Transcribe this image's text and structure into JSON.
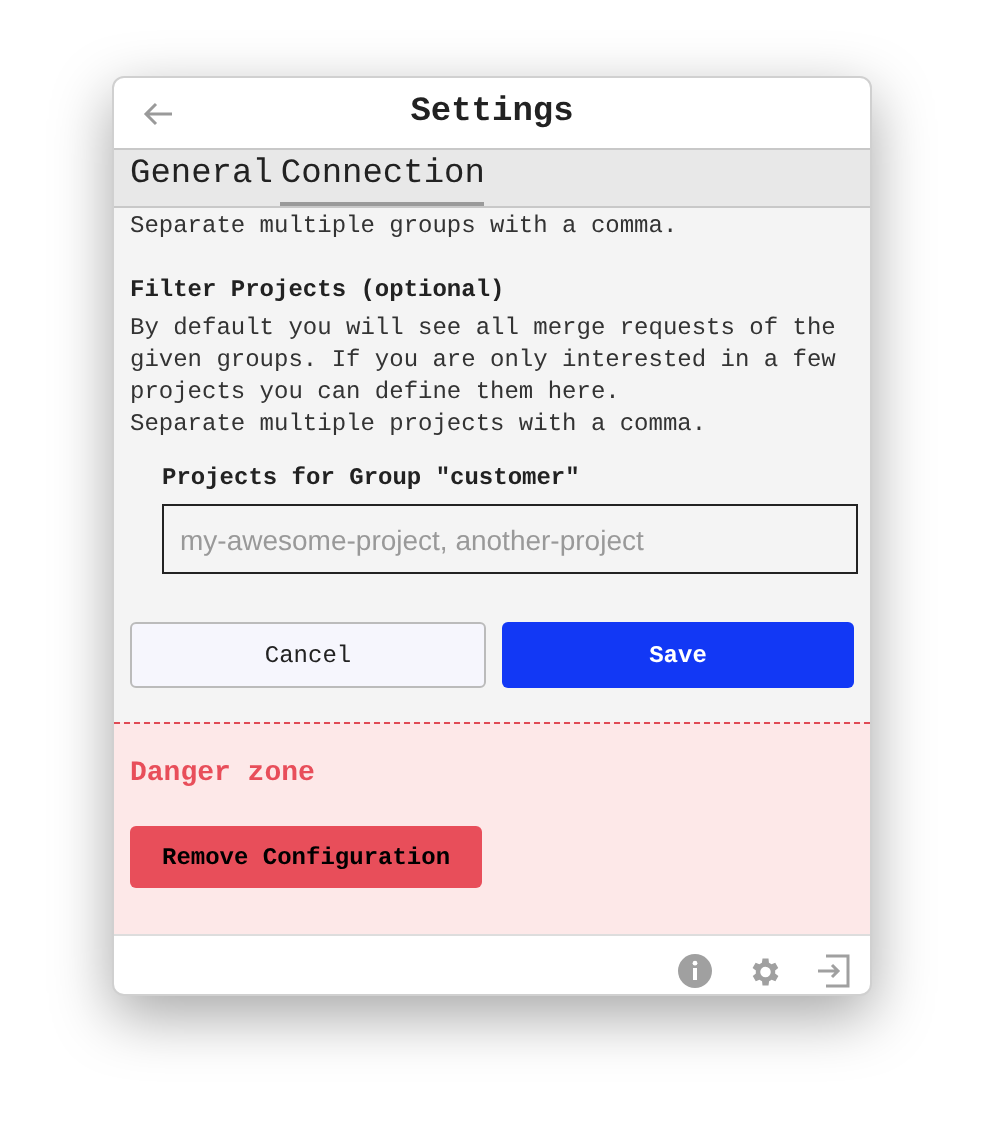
{
  "window": {
    "title": "Settings"
  },
  "tabs": [
    {
      "label": "General",
      "selected": false
    },
    {
      "label": "Connection",
      "selected": true
    }
  ],
  "cut_off_text": "Separate multiple groups with a comma.",
  "filter_section": {
    "heading": "Filter Projects (optional)",
    "description_lines": [
      "By default you will see all merge requests of the",
      "given groups. If you are only interested in a few",
      "projects you can define them here.",
      "Separate multiple projects with a comma."
    ]
  },
  "field": {
    "label": "Projects for Group \"customer\"",
    "placeholder": "my-awesome-project, another-project"
  },
  "buttons": [
    {
      "label": "Cancel",
      "kind": "secondary"
    },
    {
      "label": "Save",
      "kind": "primary"
    }
  ],
  "danger_zone": {
    "heading": "Danger zone",
    "button": "Remove Configuration"
  }
}
